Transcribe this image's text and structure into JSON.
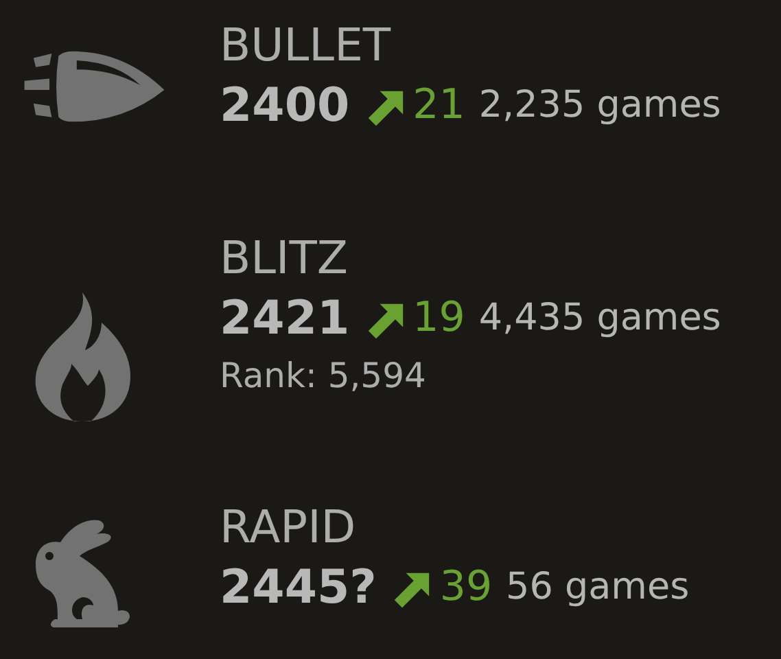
{
  "modes": [
    {
      "kind": "bullet",
      "title": "BULLET",
      "rating": "2400",
      "rising": true,
      "change": "21",
      "games": "2,235 games"
    },
    {
      "kind": "blitz",
      "title": "BLITZ",
      "rating": "2421",
      "rising": true,
      "change": "19",
      "games": "4,435 games",
      "rank": "Rank: 5,594"
    },
    {
      "kind": "rapid",
      "title": "RAPID",
      "rating": "2445?",
      "rising": true,
      "change": "39",
      "games": "56 games"
    }
  ]
}
